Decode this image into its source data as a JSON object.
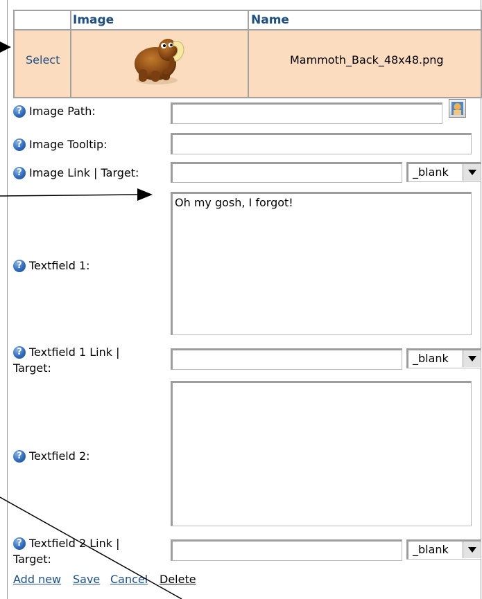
{
  "table": {
    "headers": [
      "Image",
      "Name"
    ],
    "row": {
      "select_label": "Select",
      "image_icon": "mammoth-icon",
      "filename": "Mammoth_Back_48x48.png"
    }
  },
  "form": {
    "image_path": {
      "label": "Image Path:",
      "value": ""
    },
    "image_tooltip": {
      "label": "Image Tooltip:",
      "value": ""
    },
    "image_link": {
      "label": "Image Link | Target:",
      "value": "",
      "target": "_blank"
    },
    "textfield1": {
      "label": "Textfield 1:",
      "value": "Oh my gosh, I forgot!"
    },
    "textfield1_link": {
      "label_line1": "Textfield 1 Link |",
      "label_line2": "Target:",
      "value": "",
      "target": "_blank"
    },
    "textfield2": {
      "label": "Textfield 2:",
      "value": ""
    },
    "textfield2_link": {
      "label_line1": "Textfield 2 Link |",
      "label_line2": "Target:",
      "value": "",
      "target": "_blank"
    }
  },
  "footer": {
    "add_new": "Add new",
    "save": "Save",
    "cancel": "Cancel",
    "delete": "Delete"
  },
  "colors": {
    "header_text": "#1b4f86",
    "row_background": "#fbdcbe",
    "border": "#a1a1a1"
  }
}
